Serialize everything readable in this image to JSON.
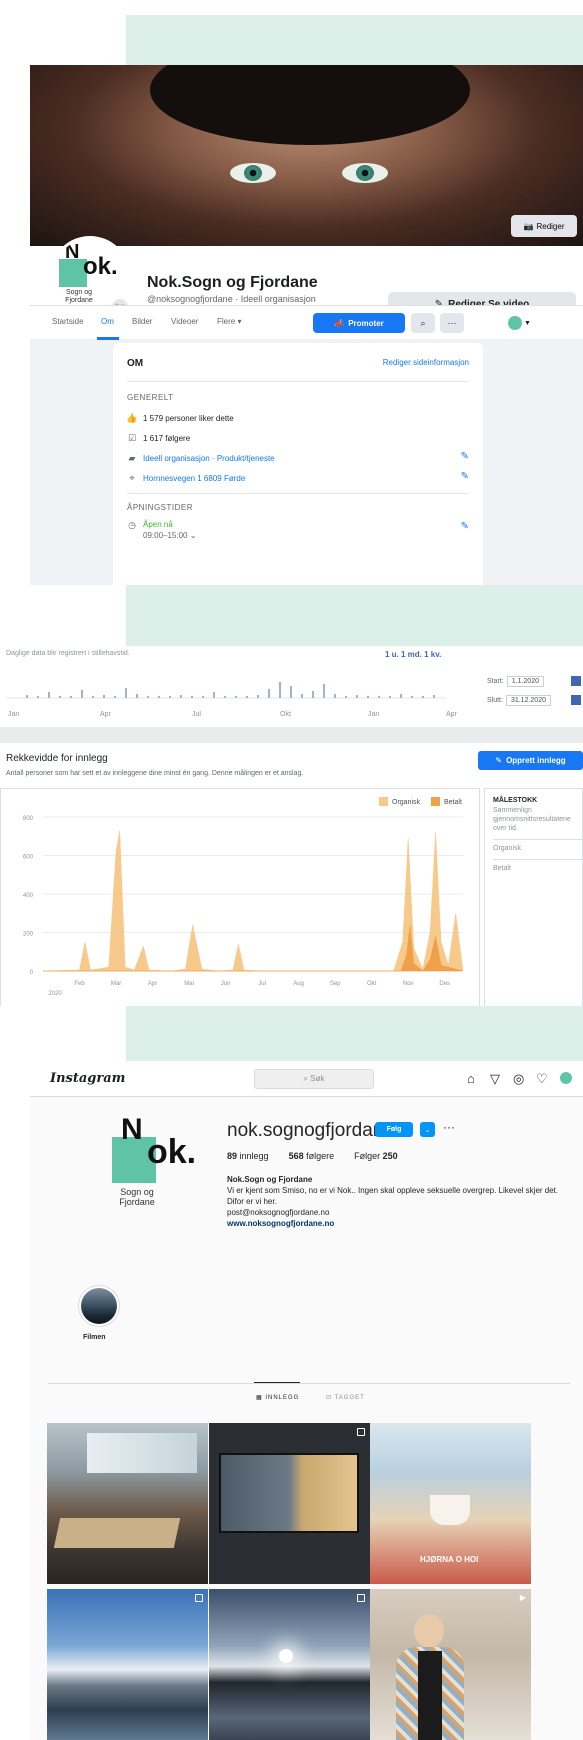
{
  "facebook": {
    "cover_edit_label": "Rediger",
    "logo": {
      "letters": "Nok.",
      "sub": "Sogn og Fjordane"
    },
    "page_name": "Nok.Sogn og Fjordane",
    "page_sub": "@noksognogfjordane · Ideell organisasjon",
    "edit_video": "Rediger Se video",
    "nav": {
      "tabs": [
        "Startside",
        "Om",
        "Bilder",
        "Videoer",
        "Flere ▾"
      ],
      "active": "Om"
    },
    "promote": "Promoter",
    "about": {
      "title": "OM",
      "edit_link": "Rediger sideinformasjon",
      "general_heading": "GENERELT",
      "likes": "1 579 personer liker dette",
      "followers": "1 617 følgere",
      "category": "Ideell organisasjon · Produkt/tjeneste",
      "address": "Hornnesvegen 1 6809 Førde",
      "hours_heading": "ÅPNINGSTIDER",
      "open_now": "Åpen nå",
      "hours": "09:00–15:00"
    }
  },
  "insights": {
    "daily_note": "Daglige data blir registrert i stillehavstid.",
    "range_links": "1 u.  1 md.  1 kv.",
    "timeline_ticks": [
      "Jan",
      "Apr",
      "Jul",
      "Okt",
      "Jan",
      "Apr"
    ],
    "start_label": "Start:",
    "start_value": "1.1.2020",
    "end_label": "Slutt:",
    "end_value": "31.12.2020",
    "reach_title": "Rekkevidde for innlegg",
    "reach_sub": "Antall personer som har sett et av innleggene dine minst én gang. Denne målingen er et anslag.",
    "create_post": "Opprett innlegg",
    "side_title": "MÅLESTOKK",
    "side_text": "Sammenlign gjennomsnittsresultatene over tid.",
    "side_organic": "Organisk",
    "side_paid": "Betalt"
  },
  "chart_data": {
    "type": "area",
    "x": [
      "Jan",
      "Feb",
      "Mar",
      "Apr",
      "Mai",
      "Jun",
      "Jul",
      "Aug",
      "Sep",
      "Okt",
      "Nov",
      "Des"
    ],
    "xlabel_year": "2020",
    "ylim": [
      0,
      800
    ],
    "yticks": [
      0,
      200,
      400,
      600,
      800
    ],
    "legend": [
      "Organisk",
      "Betalt"
    ],
    "legend_position": "top-right",
    "series": [
      {
        "name": "Organisk",
        "color": "#f7c98b",
        "points": [
          [
            0.0,
            0
          ],
          [
            1.0,
            5
          ],
          [
            1.15,
            150
          ],
          [
            1.3,
            5
          ],
          [
            1.8,
            20
          ],
          [
            2.0,
            620
          ],
          [
            2.1,
            730
          ],
          [
            2.25,
            20
          ],
          [
            2.5,
            5
          ],
          [
            2.75,
            130
          ],
          [
            2.9,
            5
          ],
          [
            3.5,
            0
          ],
          [
            3.9,
            10
          ],
          [
            4.1,
            240
          ],
          [
            4.35,
            10
          ],
          [
            4.8,
            0
          ],
          [
            5.2,
            5
          ],
          [
            5.35,
            140
          ],
          [
            5.5,
            5
          ],
          [
            6.0,
            0
          ],
          [
            7.0,
            0
          ],
          [
            8.0,
            0
          ],
          [
            9.0,
            0
          ],
          [
            9.6,
            0
          ],
          [
            9.85,
            150
          ],
          [
            10.0,
            690
          ],
          [
            10.15,
            120
          ],
          [
            10.4,
            10
          ],
          [
            10.6,
            200
          ],
          [
            10.75,
            720
          ],
          [
            10.9,
            150
          ],
          [
            11.1,
            30
          ],
          [
            11.3,
            300
          ],
          [
            11.5,
            0
          ]
        ]
      },
      {
        "name": "Betalt",
        "color": "#f0a048",
        "points": [
          [
            0.0,
            0
          ],
          [
            9.8,
            0
          ],
          [
            9.95,
            80
          ],
          [
            10.05,
            240
          ],
          [
            10.15,
            40
          ],
          [
            10.4,
            0
          ],
          [
            10.6,
            60
          ],
          [
            10.75,
            180
          ],
          [
            10.9,
            30
          ],
          [
            11.5,
            0
          ]
        ]
      }
    ]
  },
  "instagram": {
    "logo": "Instagram",
    "search_placeholder": "⌕ Søk",
    "username": "nok.sognogfjordane",
    "follow": "Følg",
    "posts_count": "89",
    "posts_label": "innlegg",
    "followers_count": "568",
    "followers_label": "følgere",
    "following_label": "Følger",
    "following_count": "250",
    "bio_name": "Nok.Sogn og Fjordane",
    "bio_text": "Vi er kjent som Smiso, no er vi Nok.. Ingen skal oppleve seksuelle overgrep. Likevel skjer det. Difor er vi her.",
    "bio_email": "post@noksognogfjordane.no",
    "bio_web": "www.noksognogfjordane.no",
    "highlight_label": "Filmen",
    "tab_posts": "▦ INNLEGG",
    "tab_tagged": "⊡ TAGGET",
    "poster_text": "HJØRNA O HOI"
  }
}
